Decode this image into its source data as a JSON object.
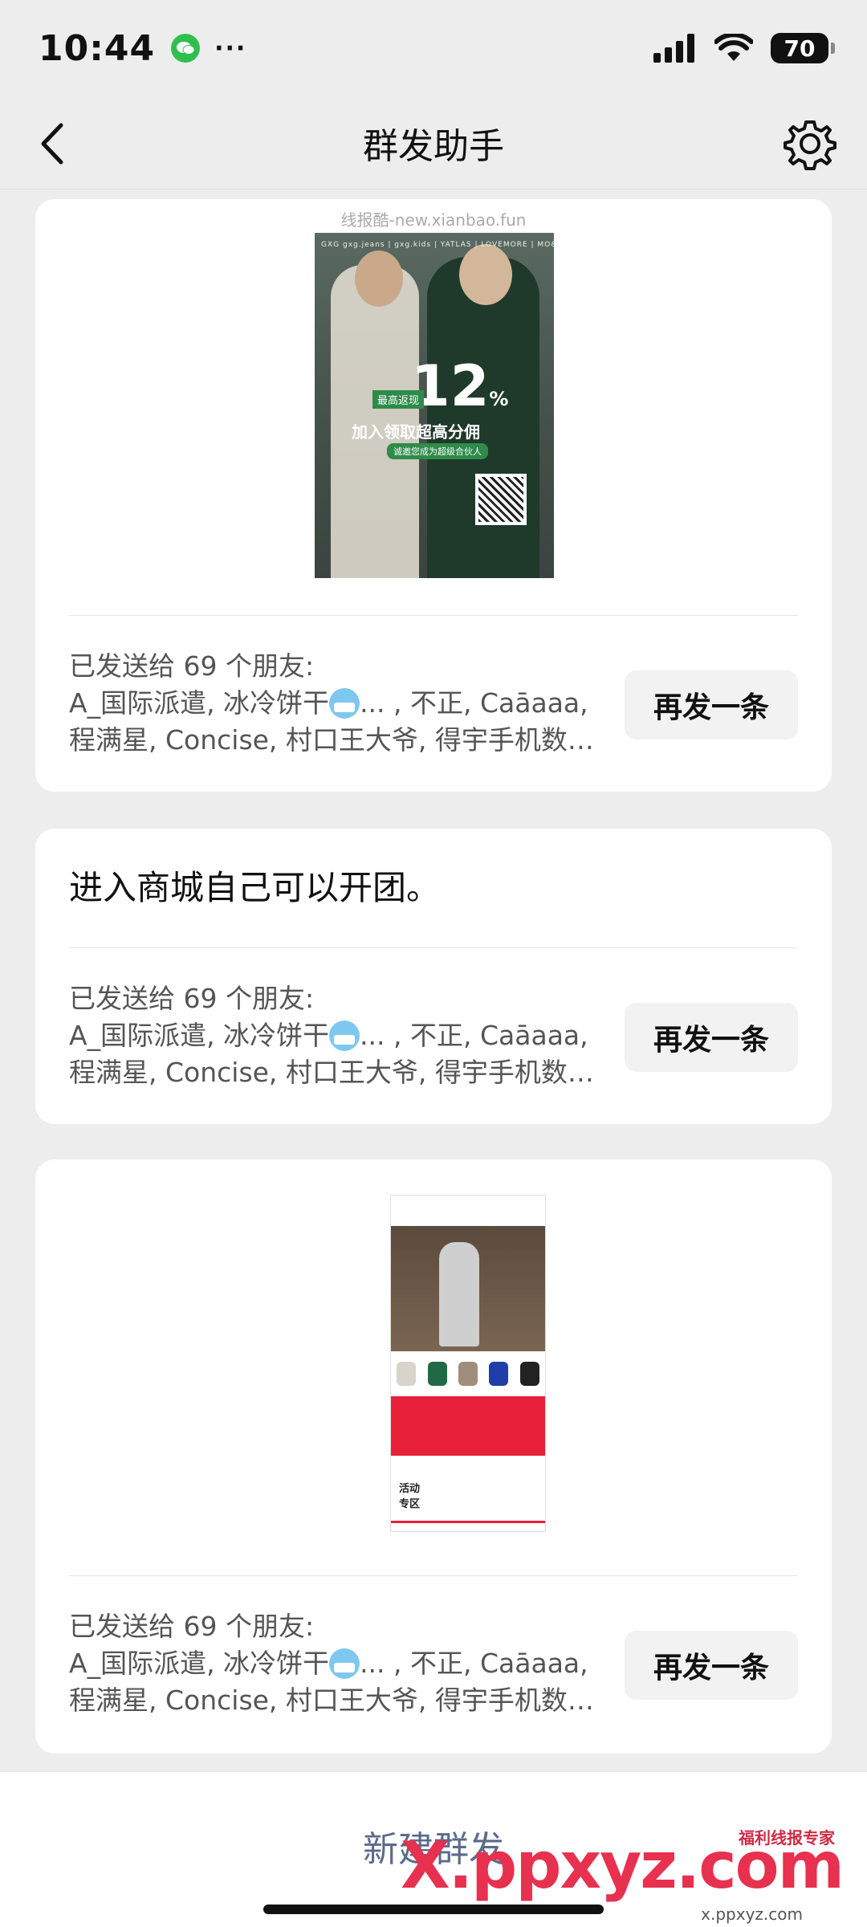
{
  "status_bar": {
    "time": "10:44",
    "dots": "···",
    "battery": "70"
  },
  "nav": {
    "title": "群发助手"
  },
  "cards": [
    {
      "image_watermark": "线报酷-new.xianbao.fun",
      "poster": {
        "brands": "GXG  gxg.jeans | gxg.kids | YATLAS | LOVEMORE | MO&Carrie",
        "percent": "12",
        "percent_unit": "%",
        "tag": "最高返现",
        "slogan": "加入领取超高分佣",
        "sub": "诚邀您成为超级合伙人"
      },
      "sent": {
        "line1": "已发送给 69 个朋友:",
        "line2_a": "A_国际派遣, 冰冷饼干",
        "line2_b": "...  , 不正, Caāaaa,",
        "line3": "程满星, Concise, 村口王大爷, 得宇手机数码…"
      },
      "resend_label": "再发一条"
    },
    {
      "text": "进入商城自己可以开团。",
      "sent": {
        "line1": "已发送给 69 个朋友:",
        "line2_a": "A_国际派遣, 冰冷饼干",
        "line2_b": "...  , 不正, Caāaaa,",
        "line3": "程满星, Concise, 村口王大爷, 得宇手机数码…"
      },
      "resend_label": "再发一条"
    },
    {
      "phone_shot": {
        "label": "活动\n专区"
      },
      "sent": {
        "line1": "已发送给 69 个朋友:",
        "line2_a": "A_国际派遣, 冰冷饼干",
        "line2_b": "...  , 不正, Caāaaa,",
        "line3": "程满星, Concise, 村口王大爷, 得宇手机数码…"
      },
      "resend_label": "再发一条"
    }
  ],
  "bottom": {
    "new_label": "新建群发"
  },
  "watermark": {
    "logo": "X.ppxyz.com",
    "small": "x.ppxyz.com",
    "badge": "福利线报专家"
  },
  "colors": {
    "accent": "#5b6b8c",
    "background": "#ededed",
    "watermark": "#e8304f"
  }
}
